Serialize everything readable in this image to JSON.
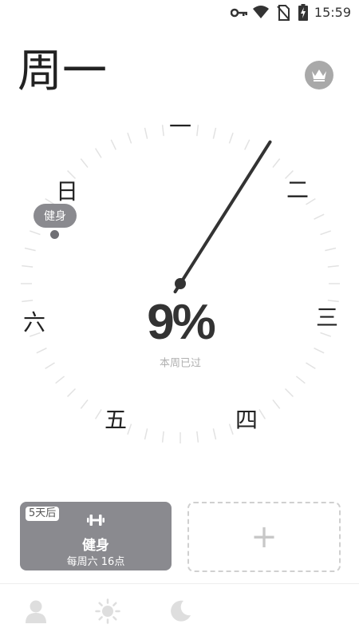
{
  "status_bar": {
    "time": "15:59",
    "icons": [
      "key-icon",
      "wifi-icon",
      "no-sim-icon",
      "battery-charging-icon"
    ]
  },
  "header": {
    "day_title": "周一",
    "vip_icon": "crown-icon"
  },
  "dial": {
    "labels": {
      "mon": "一",
      "tue": "二",
      "wed": "三",
      "thu": "四",
      "fri": "五",
      "sat": "六",
      "sun": "日"
    },
    "percent_text": "9%",
    "percent_value": 9,
    "caption": "本周已过",
    "event_marker": "健身"
  },
  "event_card": {
    "badge": "5天后",
    "icon": "dumbbell-icon",
    "title": "健身",
    "subtitle": "每周六 16点"
  },
  "add_card": {
    "symbol": "+"
  },
  "bottom_nav": [
    {
      "icon": "person-icon"
    },
    {
      "icon": "sun-icon"
    },
    {
      "icon": "moon-icon"
    }
  ],
  "colors": {
    "card": "#8a8a8f",
    "text": "#222222",
    "hand": "#333333",
    "tick": "#e2e2e2"
  }
}
